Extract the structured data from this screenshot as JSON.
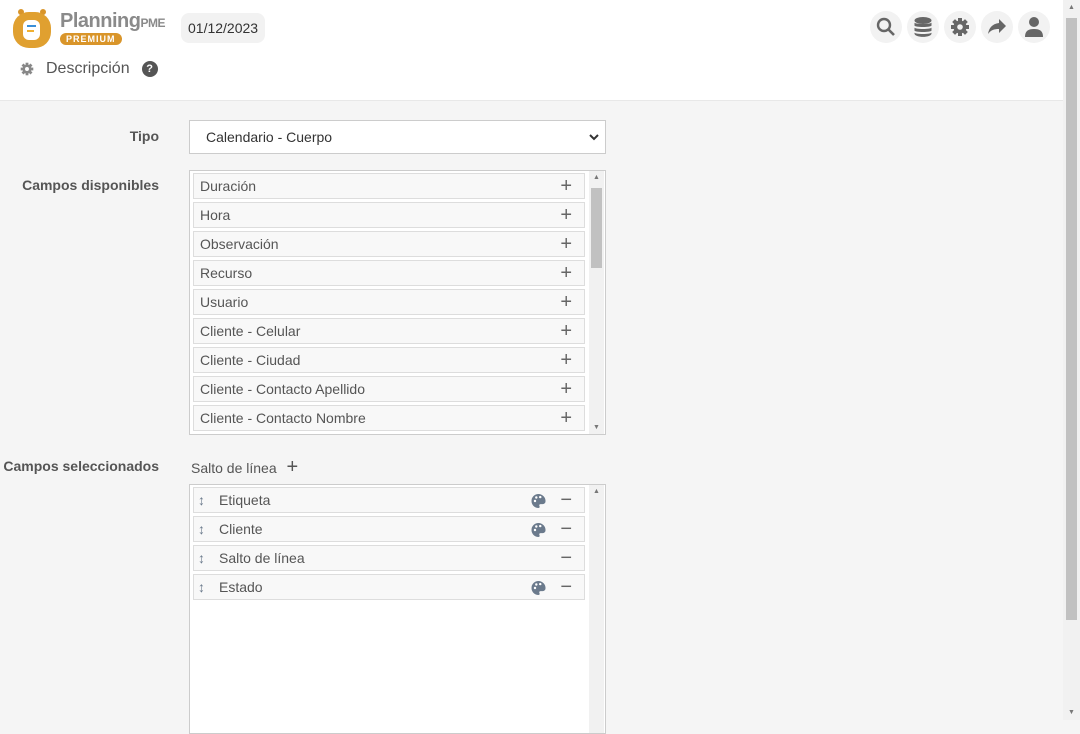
{
  "header": {
    "brand": "Planning",
    "brand_suffix": "PME",
    "badge": "PREMIUM",
    "date": "01/12/2023",
    "icons": [
      "search-icon",
      "database-icon",
      "gear-icon",
      "share-icon",
      "user-icon"
    ]
  },
  "section": {
    "title": "Descripción",
    "help": "?"
  },
  "form": {
    "tipo_label": "Tipo",
    "tipo_value": "Calendario - Cuerpo",
    "available_label": "Campos disponibles",
    "available": [
      "Duración",
      "Hora",
      "Observación",
      "Recurso",
      "Usuario",
      "Cliente - Celular",
      "Cliente - Ciudad",
      "Cliente - Contacto Apellido",
      "Cliente - Contacto Nombre"
    ],
    "selected_label": "Campos seleccionados",
    "line_break_label": "Salto de línea",
    "selected": [
      {
        "label": "Etiqueta",
        "palette": true
      },
      {
        "label": "Cliente",
        "palette": true
      },
      {
        "label": "Salto de línea",
        "palette": false
      },
      {
        "label": "Estado",
        "palette": true
      }
    ]
  }
}
